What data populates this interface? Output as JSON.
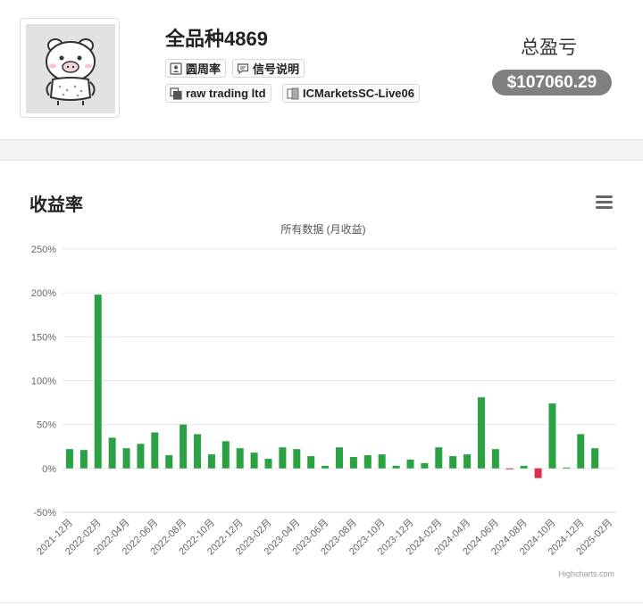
{
  "profile": {
    "name": "全品种4869",
    "tags": [
      "圆周率",
      "信号说明",
      "raw trading ltd",
      "ICMarketsSC-Live06"
    ],
    "pl_label": "总盈亏",
    "pl_value": "$107060.29"
  },
  "section": {
    "title": "收益率"
  },
  "chart_data": {
    "type": "bar",
    "title": "",
    "subtitle": "所有数据 (月收益)",
    "credits": "Highcharts.com",
    "xlabel": "",
    "ylabel": "",
    "ylim": [
      -50,
      250
    ],
    "yticks": [
      -50,
      0,
      50,
      100,
      150,
      200,
      250
    ],
    "ytick_labels": [
      "-50%",
      "0%",
      "50%",
      "100%",
      "150%",
      "200%",
      "250%"
    ],
    "grid": true,
    "legend": false,
    "x_tick_labels": [
      "2021-12月",
      "2022-02月",
      "2022-04月",
      "2022-06月",
      "2022-08月",
      "2022-10月",
      "2022-12月",
      "2023-02月",
      "2023-04月",
      "2023-06月",
      "2023-08月",
      "2023-10月",
      "2023-12月",
      "2024-02月",
      "2024-04月",
      "2024-06月",
      "2024-08月",
      "2024-10月",
      "2024-12月",
      "2025-02月"
    ],
    "categories": [
      "2021-12月",
      "2022-01月",
      "2022-02月",
      "2022-03月",
      "2022-04月",
      "2022-05月",
      "2022-06月",
      "2022-07月",
      "2022-08月",
      "2022-09月",
      "2022-10月",
      "2022-11月",
      "2022-12月",
      "2023-01月",
      "2023-02月",
      "2023-03月",
      "2023-04月",
      "2023-05月",
      "2023-06月",
      "2023-07月",
      "2023-08月",
      "2023-09月",
      "2023-10月",
      "2023-11月",
      "2023-12月",
      "2024-01月",
      "2024-02月",
      "2024-03月",
      "2024-04月",
      "2024-05月",
      "2024-06月",
      "2024-07月",
      "2024-08月",
      "2024-09月",
      "2024-10月",
      "2024-11月",
      "2024-12月",
      "2025-01月",
      "2025-02月"
    ],
    "values": [
      22,
      21,
      198,
      35,
      23,
      28,
      41,
      15,
      50,
      39,
      16,
      31,
      23,
      18,
      11,
      24,
      22,
      14,
      3,
      24,
      13,
      15,
      16,
      3,
      10,
      6,
      24,
      14,
      16,
      81,
      22,
      -1,
      3,
      -11,
      74,
      1,
      39,
      23
    ],
    "colors": {
      "positive": "#2aa244",
      "negative": "#d9304b"
    }
  }
}
